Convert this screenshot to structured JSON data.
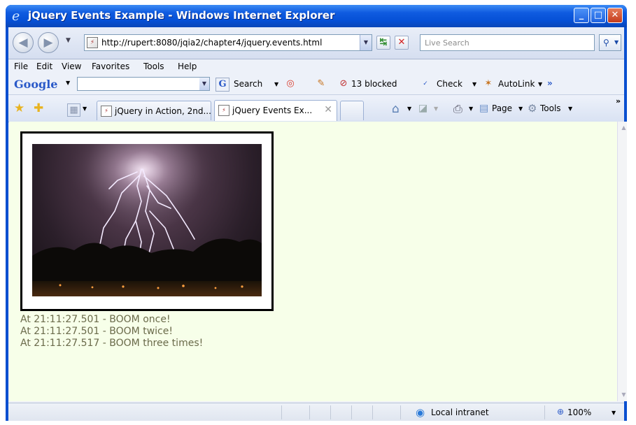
{
  "window": {
    "title": "jQuery Events Example - Windows Internet Explorer",
    "buttons": [
      "_",
      "□",
      "✕"
    ]
  },
  "address_bar": {
    "url": "http://rupert:8080/jqia2/chapter4/jquery.events.html",
    "search_placeholder": "Live Search"
  },
  "menu": {
    "items": [
      "File",
      "Edit",
      "View",
      "Favorites",
      "Tools",
      "Help"
    ]
  },
  "google_toolbar": {
    "logo": "Google",
    "search_label": "Search",
    "blocked_label": "13 blocked",
    "check_label": "Check",
    "autolink_label": "AutoLink"
  },
  "tabs": [
    {
      "label": "jQuery in Action, 2nd..."
    },
    {
      "label": "jQuery Events Ex..."
    }
  ],
  "command_bar": {
    "page_label": "Page",
    "tools_label": "Tools"
  },
  "log_lines": [
    "At 21:11:27.501 - BOOM once!",
    "At 21:11:27.501 - BOOM twice!",
    "At 21:11:27.517 - BOOM three times!"
  ],
  "status_bar": {
    "zone": "Local intranet",
    "zoom": "100%"
  }
}
